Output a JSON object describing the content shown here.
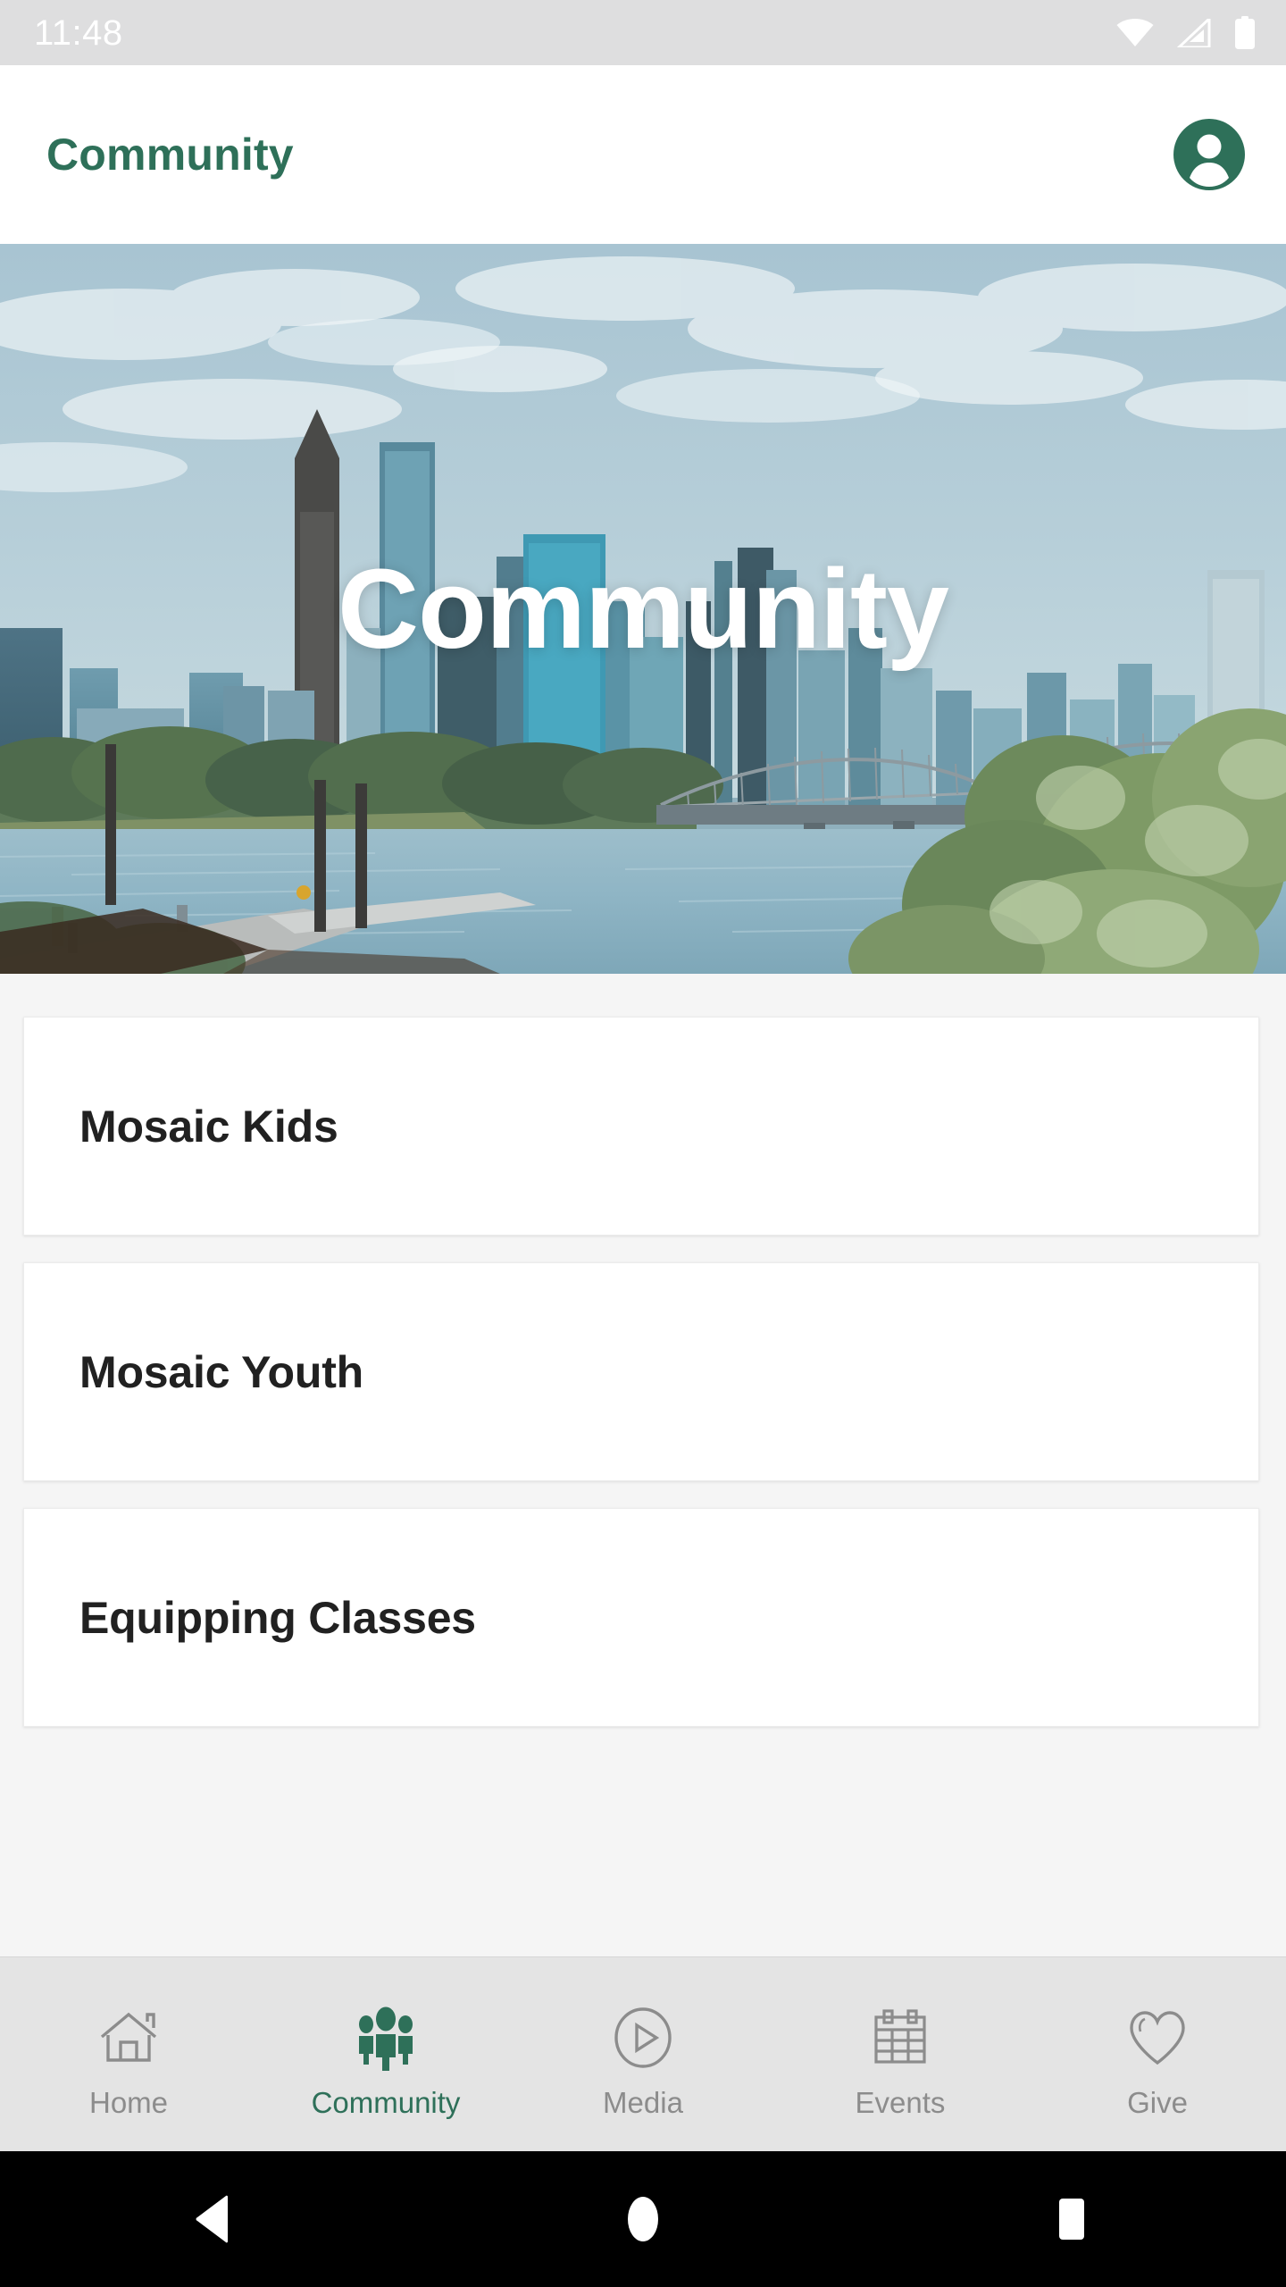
{
  "status_bar": {
    "time": "11:48",
    "icons": [
      "wifi-icon",
      "cellular-signal-icon",
      "battery-icon"
    ]
  },
  "app_bar": {
    "title": "Community",
    "avatar_icon": "account-circle-icon",
    "title_color": "#2e7059"
  },
  "hero": {
    "title": "Community",
    "image_description": "Portland skyline with Hawthorne Bridge over the Willamette River, dock in foreground"
  },
  "content": {
    "cards": [
      {
        "title": "Mosaic Kids"
      },
      {
        "title": "Mosaic Youth"
      },
      {
        "title": "Equipping Classes"
      }
    ]
  },
  "bottom_nav": {
    "active_color": "#2e7059",
    "inactive_color": "#8c8c8c",
    "items": [
      {
        "label": "Home",
        "icon": "home-icon",
        "active": false
      },
      {
        "label": "Community",
        "icon": "people-icon",
        "active": true
      },
      {
        "label": "Media",
        "icon": "play-circle-icon",
        "active": false
      },
      {
        "label": "Events",
        "icon": "calendar-icon",
        "active": false
      },
      {
        "label": "Give",
        "icon": "heart-icon",
        "active": false
      }
    ]
  },
  "system_nav": {
    "buttons": [
      {
        "name": "back-button",
        "icon": "triangle-left-icon"
      },
      {
        "name": "home-button",
        "icon": "circle-icon"
      },
      {
        "name": "recents-button",
        "icon": "square-icon"
      }
    ]
  }
}
